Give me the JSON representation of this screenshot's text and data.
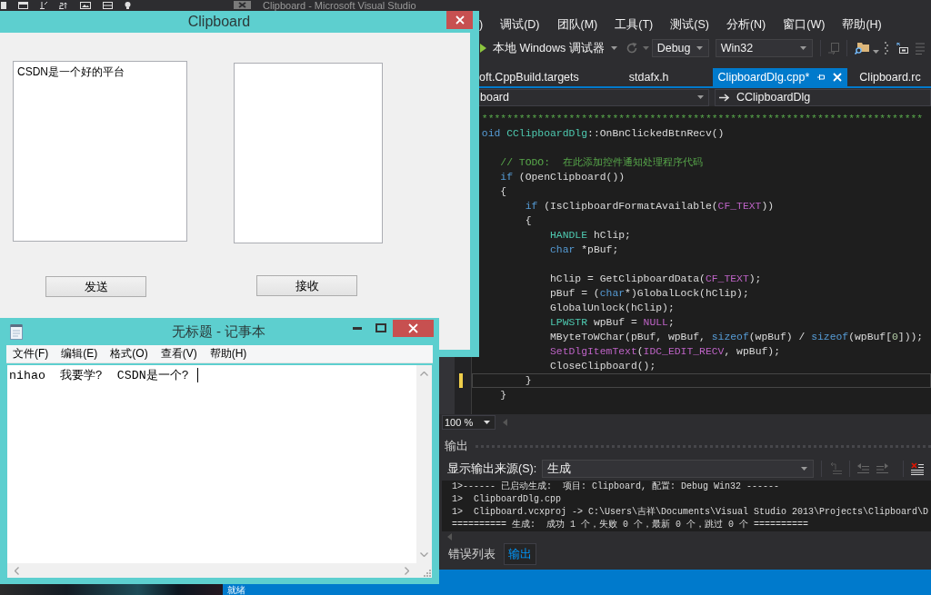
{
  "visual_studio": {
    "title": "Clipboard - Microsoft Visual Studio",
    "menu": [
      ")",
      "调试(D)",
      "团队(M)",
      "工具(T)",
      "测试(S)",
      "分析(N)",
      "窗口(W)",
      "帮助(H)"
    ],
    "toolbar": {
      "debugger": "本地 Windows 调试器",
      "configuration": "Debug",
      "platform": "Win32"
    },
    "tabs": [
      {
        "label": "oft.CppBuild.targets",
        "selected": false
      },
      {
        "label": "stdafx.h",
        "selected": false
      },
      {
        "label": "ClipboardDlg.cpp*",
        "selected": true
      },
      {
        "label": "Clipboard.rc",
        "selected": false
      }
    ],
    "navigation": {
      "scope": "board",
      "member": "CClipboardDlg"
    },
    "code_lines": [
      {
        "current": false,
        "modified": false,
        "tokens": [
          {
            "kind": "comment",
            "text": " ***********************************************************************"
          }
        ]
      },
      {
        "current": false,
        "modified": false,
        "tokens": [
          {
            "kind": "keyword",
            "text": " oid"
          },
          {
            "kind": "type",
            "text": " CClipboardDlg"
          },
          {
            "kind": "plain",
            "text": "::OnBnClickedBtnRecv()"
          }
        ]
      },
      {
        "current": false,
        "modified": false
      },
      {
        "current": false,
        "modified": false,
        "tokens": [
          {
            "kind": "comment",
            "text": "    // TODO:  在此添加控件通知处理程序代码"
          }
        ]
      },
      {
        "current": false,
        "modified": false,
        "tokens": [
          {
            "kind": "keyword",
            "text": "    if"
          },
          {
            "kind": "plain",
            "text": " (OpenClipboard())"
          }
        ]
      },
      {
        "current": false,
        "modified": false,
        "tokens": [
          {
            "kind": "plain",
            "text": "    {"
          }
        ]
      },
      {
        "current": false,
        "modified": false,
        "tokens": [
          {
            "kind": "keyword",
            "text": "        if"
          },
          {
            "kind": "plain",
            "text": " (IsClipboardFormatAvailable("
          },
          {
            "kind": "macro",
            "text": "CF_TEXT"
          },
          {
            "kind": "plain",
            "text": "))"
          }
        ]
      },
      {
        "current": false,
        "modified": false,
        "tokens": [
          {
            "kind": "plain",
            "text": "        {"
          }
        ]
      },
      {
        "current": false,
        "modified": false,
        "tokens": [
          {
            "kind": "type",
            "text": "            HANDLE"
          },
          {
            "kind": "plain",
            "text": " hClip;"
          }
        ]
      },
      {
        "current": false,
        "modified": false,
        "tokens": [
          {
            "kind": "keyword",
            "text": "            char"
          },
          {
            "kind": "plain",
            "text": " *pBuf;"
          }
        ]
      },
      {
        "current": false,
        "modified": false
      },
      {
        "current": false,
        "modified": false,
        "tokens": [
          {
            "kind": "plain",
            "text": "            hClip = GetClipboardData("
          },
          {
            "kind": "macro",
            "text": "CF_TEXT"
          },
          {
            "kind": "plain",
            "text": ");"
          }
        ]
      },
      {
        "current": false,
        "modified": false,
        "tokens": [
          {
            "kind": "plain",
            "text": "            pBuf = ("
          },
          {
            "kind": "keyword",
            "text": "char"
          },
          {
            "kind": "plain",
            "text": "*)GlobalLock(hClip);"
          }
        ]
      },
      {
        "current": false,
        "modified": false,
        "tokens": [
          {
            "kind": "plain",
            "text": "            GlobalUnlock(hClip);"
          }
        ]
      },
      {
        "current": false,
        "modified": false,
        "tokens": [
          {
            "kind": "type",
            "text": "            LPWSTR"
          },
          {
            "kind": "plain",
            "text": " wpBuf = "
          },
          {
            "kind": "macro",
            "text": "NULL"
          },
          {
            "kind": "plain",
            "text": ";"
          }
        ]
      },
      {
        "current": false,
        "modified": false,
        "tokens": [
          {
            "kind": "plain",
            "text": "            MByteToWChar(pBuf, wpBuf, "
          },
          {
            "kind": "keyword",
            "text": "sizeof"
          },
          {
            "kind": "plain",
            "text": "(wpBuf) / "
          },
          {
            "kind": "keyword",
            "text": "sizeof"
          },
          {
            "kind": "plain",
            "text": "(wpBuf["
          },
          {
            "kind": "number",
            "text": "0"
          },
          {
            "kind": "plain",
            "text": "]));"
          }
        ]
      },
      {
        "current": false,
        "modified": false,
        "tokens": [
          {
            "kind": "macro",
            "text": "            SetDlgItemText"
          },
          {
            "kind": "plain",
            "text": "("
          },
          {
            "kind": "macro",
            "text": "IDC_EDIT_RECV"
          },
          {
            "kind": "plain",
            "text": ", wpBuf);"
          }
        ]
      },
      {
        "current": false,
        "modified": false,
        "tokens": [
          {
            "kind": "plain",
            "text": "            CloseClipboard();"
          }
        ]
      },
      {
        "current": true,
        "modified": true,
        "tokens": [
          {
            "kind": "plain",
            "text": "        }"
          }
        ]
      },
      {
        "current": false,
        "modified": false,
        "tokens": [
          {
            "kind": "plain",
            "text": "    }"
          }
        ]
      }
    ],
    "zoom": "100 %",
    "output": {
      "title": "输出",
      "source_label": "显示输出来源(S):",
      "source": "生成",
      "lines": [
        "1>------ 已启动生成:  项目: Clipboard, 配置: Debug Win32 ------",
        "1>  ClipboardDlg.cpp",
        "1>  Clipboard.vcxproj -> C:\\Users\\吉祥\\Documents\\Visual Studio 2013\\Projects\\Clipboard\\D",
        "========== 生成:  成功 1 个，失败 0 个，最新 0 个，跳过 0 个 =========="
      ]
    },
    "panel_tabs": [
      {
        "label": "错误列表",
        "selected": false
      },
      {
        "label": "输出",
        "selected": true
      }
    ],
    "status": "就绪"
  },
  "clipboard_dialog": {
    "title": "Clipboard",
    "send_field": {
      "value": "CSDN是一个好的平台"
    },
    "buttons": [
      "发送",
      "接收"
    ]
  },
  "notepad": {
    "title": "无标题 - 记事本",
    "menu": [
      "文件(F)",
      "编辑(E)",
      "格式(O)",
      "查看(V)",
      "帮助(H)"
    ],
    "editor": {
      "value": "nihao  我要学?  CSDN是一个?"
    }
  }
}
